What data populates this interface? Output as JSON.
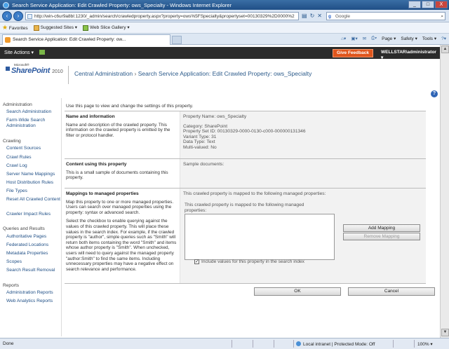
{
  "window": {
    "title": "Search Service Application: Edit Crawled Property: ows_Specialty - Windows Internet Explorer",
    "minimize": "_",
    "maximize": "□",
    "close": "X"
  },
  "browser": {
    "url": "http://win-c6ur9a8bl:1230/_admin/search/crawledproperty.aspx?property=ows%5FSpecialty&propertyset=00130329%2D0000%2",
    "search_placeholder": "Google",
    "favorites_label": "Favorites",
    "fav_items": [
      "Suggested Sites ▾",
      "Web Slice Gallery ▾"
    ],
    "tab_title": "Search Service Application: Edit Crawled Property: ow...",
    "commands": [
      "Page ▾",
      "Safety ▾",
      "Tools ▾"
    ]
  },
  "sp_top": {
    "site_actions": "Site Actions ▾",
    "feedback": "Give Feedback",
    "user": "WELLSTAR\\administrator ▾"
  },
  "header": {
    "logo_microsoft": "Microsoft®",
    "logo_product": "SharePoint",
    "logo_year": "2010",
    "breadcrumb_root": "Central Administration",
    "breadcrumb_sep": "›",
    "breadcrumb_current": "Search Service Application: Edit Crawled Property: ows_Specialty",
    "help": "?"
  },
  "leftnav": {
    "sections": [
      {
        "heading": "Administration",
        "items": [
          "Search Administration",
          "Farm-Wide Search Administration"
        ]
      },
      {
        "heading": "Crawling",
        "items": [
          "Content Sources",
          "Crawl Rules",
          "Crawl Log",
          "Server Name Mappings",
          "Host Distribution Rules",
          "File Types",
          "Reset All Crawled Content",
          "Crawler Impact Rules"
        ]
      },
      {
        "heading": "Queries and Results",
        "items": [
          "Authoritative Pages",
          "Federated Locations",
          "Metadata Properties",
          "Scopes",
          "Search Result Removal"
        ]
      },
      {
        "heading": "Reports",
        "items": [
          "Administration Reports",
          "Web Analytics Reports"
        ]
      }
    ]
  },
  "main": {
    "intro": "Use this page to view and change the settings of this property.",
    "name_section": {
      "title": "Name and information",
      "desc": "Name and description of the crawled property. This information on the crawled property is emitted by the filter or protocol handler.",
      "property_name": "Property Name:  ows_Specialty",
      "category": "Category: SharePoint",
      "property_set": "Property Set ID: 00130329-0000-0130-c000-000000131346",
      "variant": "Variant Type: 31",
      "data_type": "Data Type: Text",
      "multi": "Multi-valued: No"
    },
    "content_section": {
      "title": "Content using this property",
      "desc": "This is a small sample of documents containing this property.",
      "sample": "Sample documents:"
    },
    "mapping_section": {
      "title": "Mappings to managed properties",
      "desc1": "Map this property to one or more managed properties. Users can search over managed properties using the property: syntax or advanced search.",
      "desc2": "Select the checkbox to enable querying against the values of this crawled property. This will place these values in the search index. For example, if the crawled property is \"author\", simple queries such as \"Smith\" will return both items containing the word \"Smith\" and items whose author property is \"Smith\". When unchecked, users will need to query against the managed property \"author:Smith\" to find the same items. Including unnecessary properties may have a negative effect on search relevance and performance.",
      "mapped_text": "This crawled property is mapped to the following managed properties:",
      "mapped_text2": "This crawled property is mapped to the following managed properties:",
      "add_mapping": "Add Mapping",
      "remove_mapping": "Remove Mapping",
      "include_label": "Include values for this property in the search index",
      "include_checked": "✓"
    },
    "ok": "OK",
    "cancel": "Cancel"
  },
  "status": {
    "done": "Done",
    "zone": "Local intranet | Protected Mode: Off",
    "zoom": "100% ▾"
  },
  "colors": {
    "sp_topbar": "#2b2b2b",
    "feedback": "#e0561d",
    "link": "#1f4f86",
    "panel": "#f2f2f2"
  }
}
